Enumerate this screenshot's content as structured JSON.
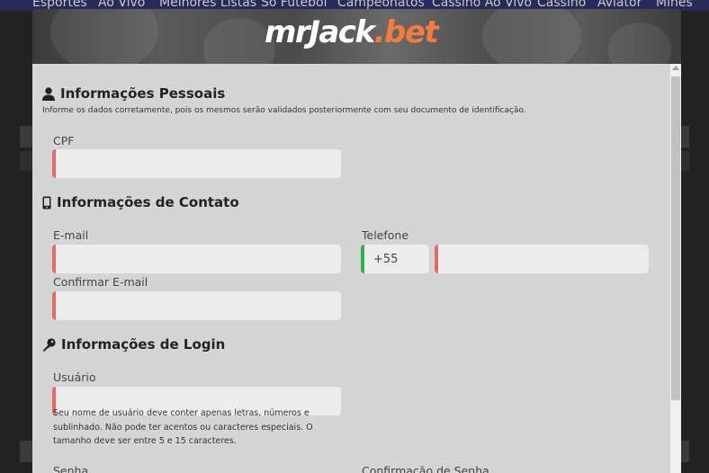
{
  "background": {
    "nav_items": [
      "Esportes",
      "Ao Vivo",
      "Melhores Listas",
      "Só Futebol",
      "Campeonatos",
      "Cassino Ao Vivo",
      "Cassino",
      "Aviator",
      "Mines"
    ]
  },
  "brand": {
    "logo_left": "mrJack",
    "logo_right": ".bet",
    "accent": "#f47c3c"
  },
  "personal": {
    "title": "Informações Pessoais",
    "icon": "user-icon",
    "description": "Informe os dados corretamente, pois os mesmos serão validados posteriormente com seu documento de identificação.",
    "cpf_label": "CPF",
    "cpf_value": ""
  },
  "contact": {
    "title": "Informações de Contato",
    "icon": "mobile-icon",
    "email_label": "E-mail",
    "email_value": "",
    "confirm_email_label": "Confirmar E-mail",
    "confirm_email_value": "",
    "phone_label": "Telefone",
    "phone_code": "+55",
    "phone_value": ""
  },
  "login": {
    "title": "Informações de Login",
    "icon": "key-icon",
    "username_label": "Usuário",
    "username_value": "",
    "username_help": "Seu nome de usuário deve conter apenas letras, números e sublinhado. Não pode ter acentos ou caracteres especiais. O tamanho deve ser entre 5 e 15 caracteres.",
    "password_label": "Senha",
    "confirm_password_label": "Confirmação de Senha"
  },
  "colors": {
    "required": "#e06b6b",
    "valid": "#29b34a"
  }
}
